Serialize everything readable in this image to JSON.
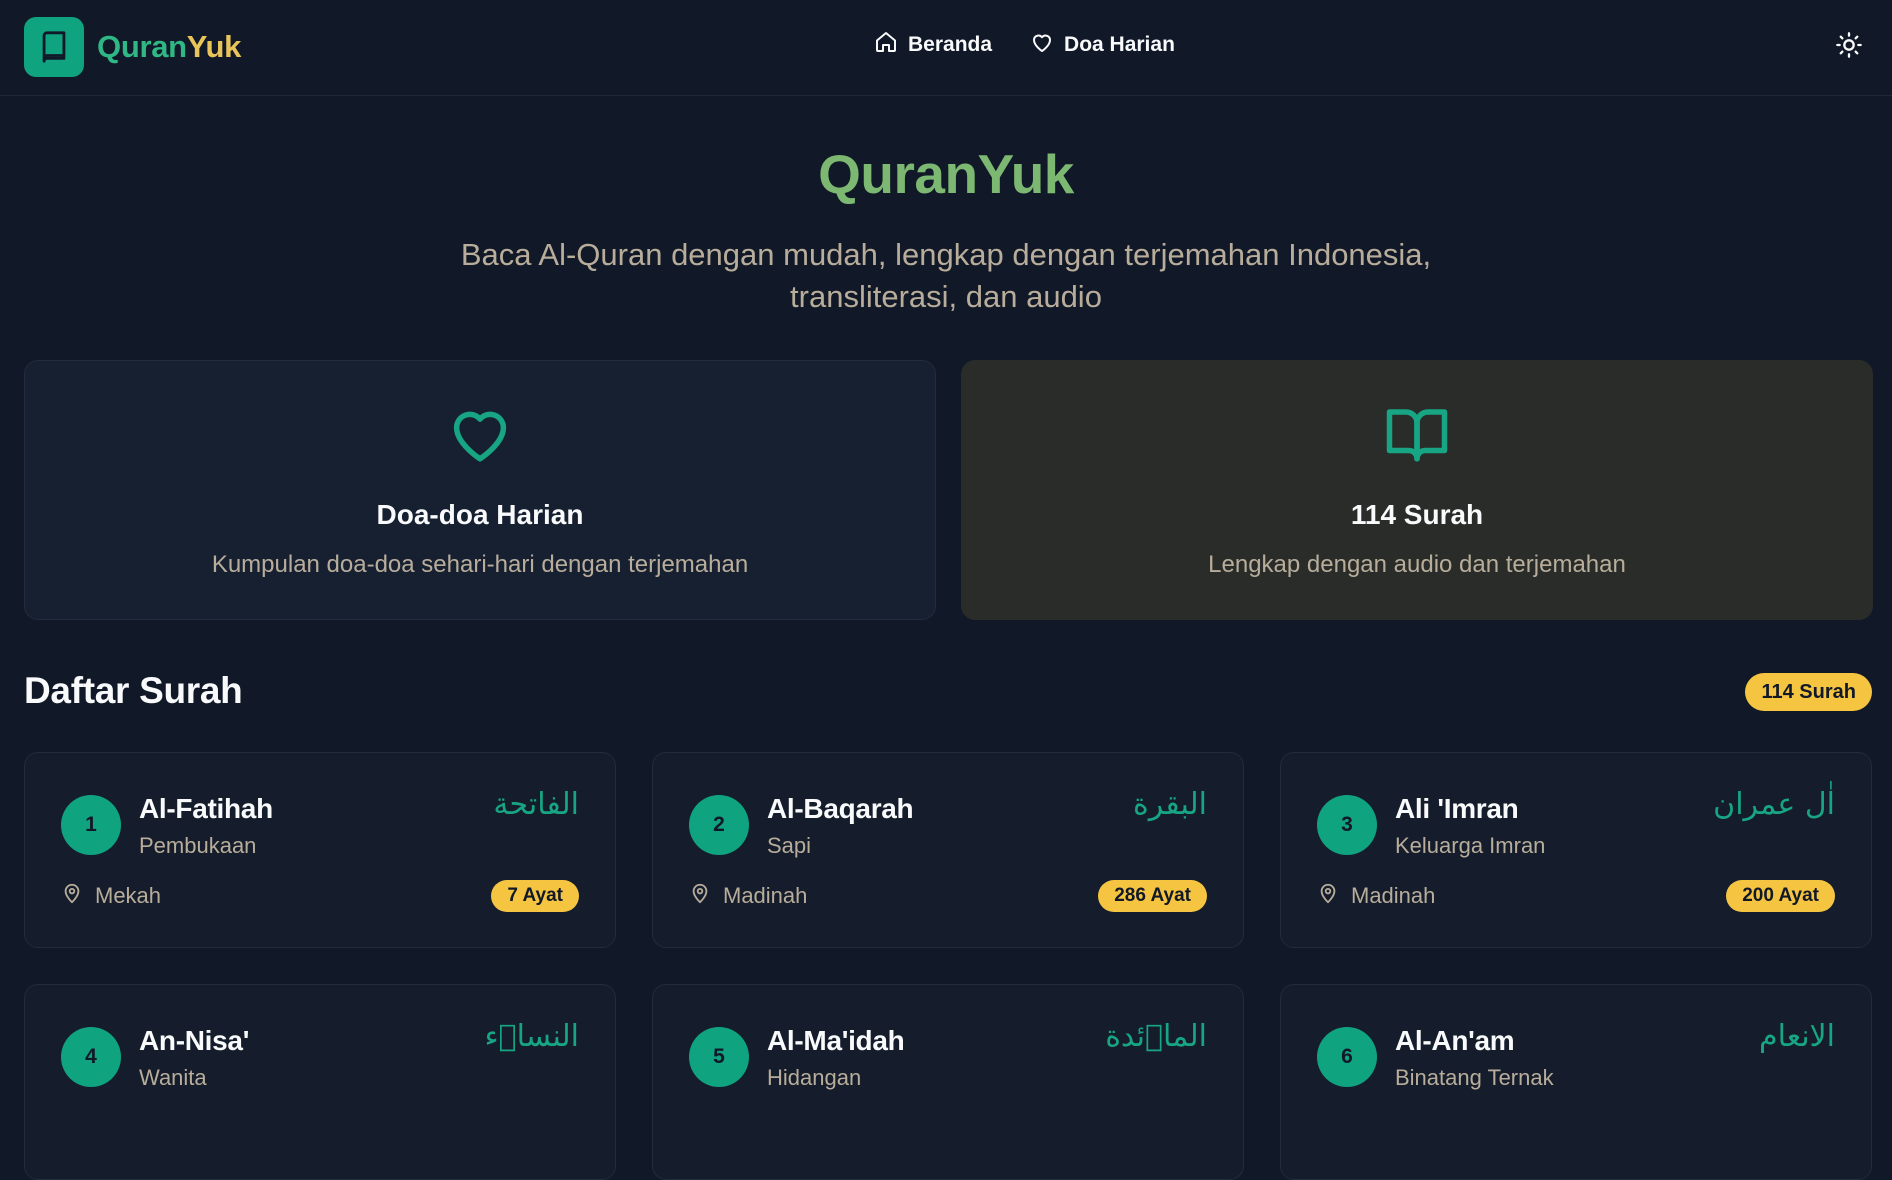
{
  "brand": {
    "name_part1": "Quran",
    "name_part2": "Yuk"
  },
  "nav": {
    "items": [
      {
        "label": "Beranda",
        "icon": "home-icon"
      },
      {
        "label": "Doa Harian",
        "icon": "heart-icon"
      }
    ],
    "theme_icon": "sun-icon"
  },
  "hero": {
    "title": "QuranYuk",
    "subtitle": "Baca Al-Quran dengan mudah, lengkap dengan terjemahan Indonesia, transliterasi, dan audio"
  },
  "features": [
    {
      "title": "Doa-doa Harian",
      "desc": "Kumpulan doa-doa sehari-hari dengan terjemahan",
      "icon": "heart-icon"
    },
    {
      "title": "114 Surah",
      "desc": "Lengkap dengan audio dan terjemahan",
      "icon": "open-book-icon"
    }
  ],
  "surah_list": {
    "title": "Daftar Surah",
    "count_badge": "114 Surah",
    "items": [
      {
        "number": "1",
        "name": "Al-Fatihah",
        "meaning": "Pembukaan",
        "arabic": "الفاتحة",
        "place": "Mekah",
        "ayat": "7 Ayat"
      },
      {
        "number": "2",
        "name": "Al-Baqarah",
        "meaning": "Sapi",
        "arabic": "البقرة",
        "place": "Madinah",
        "ayat": "286 Ayat"
      },
      {
        "number": "3",
        "name": "Ali 'Imran",
        "meaning": "Keluarga Imran",
        "arabic": "اٰل عمران",
        "place": "Madinah",
        "ayat": "200 Ayat"
      },
      {
        "number": "4",
        "name": "An-Nisa'",
        "meaning": "Wanita",
        "arabic": "النساۤء",
        "place": "",
        "ayat": ""
      },
      {
        "number": "5",
        "name": "Al-Ma'idah",
        "meaning": "Hidangan",
        "arabic": "الماۤئدة",
        "place": "",
        "ayat": ""
      },
      {
        "number": "6",
        "name": "Al-An'am",
        "meaning": "Binatang Ternak",
        "arabic": "الانعام",
        "place": "",
        "ayat": ""
      }
    ]
  },
  "colors": {
    "background": "#111827",
    "accent_green": "#10a37f",
    "accent_yellow": "#f5c542",
    "hero_title": "#7db872",
    "muted_text": "#b8ad9b"
  }
}
